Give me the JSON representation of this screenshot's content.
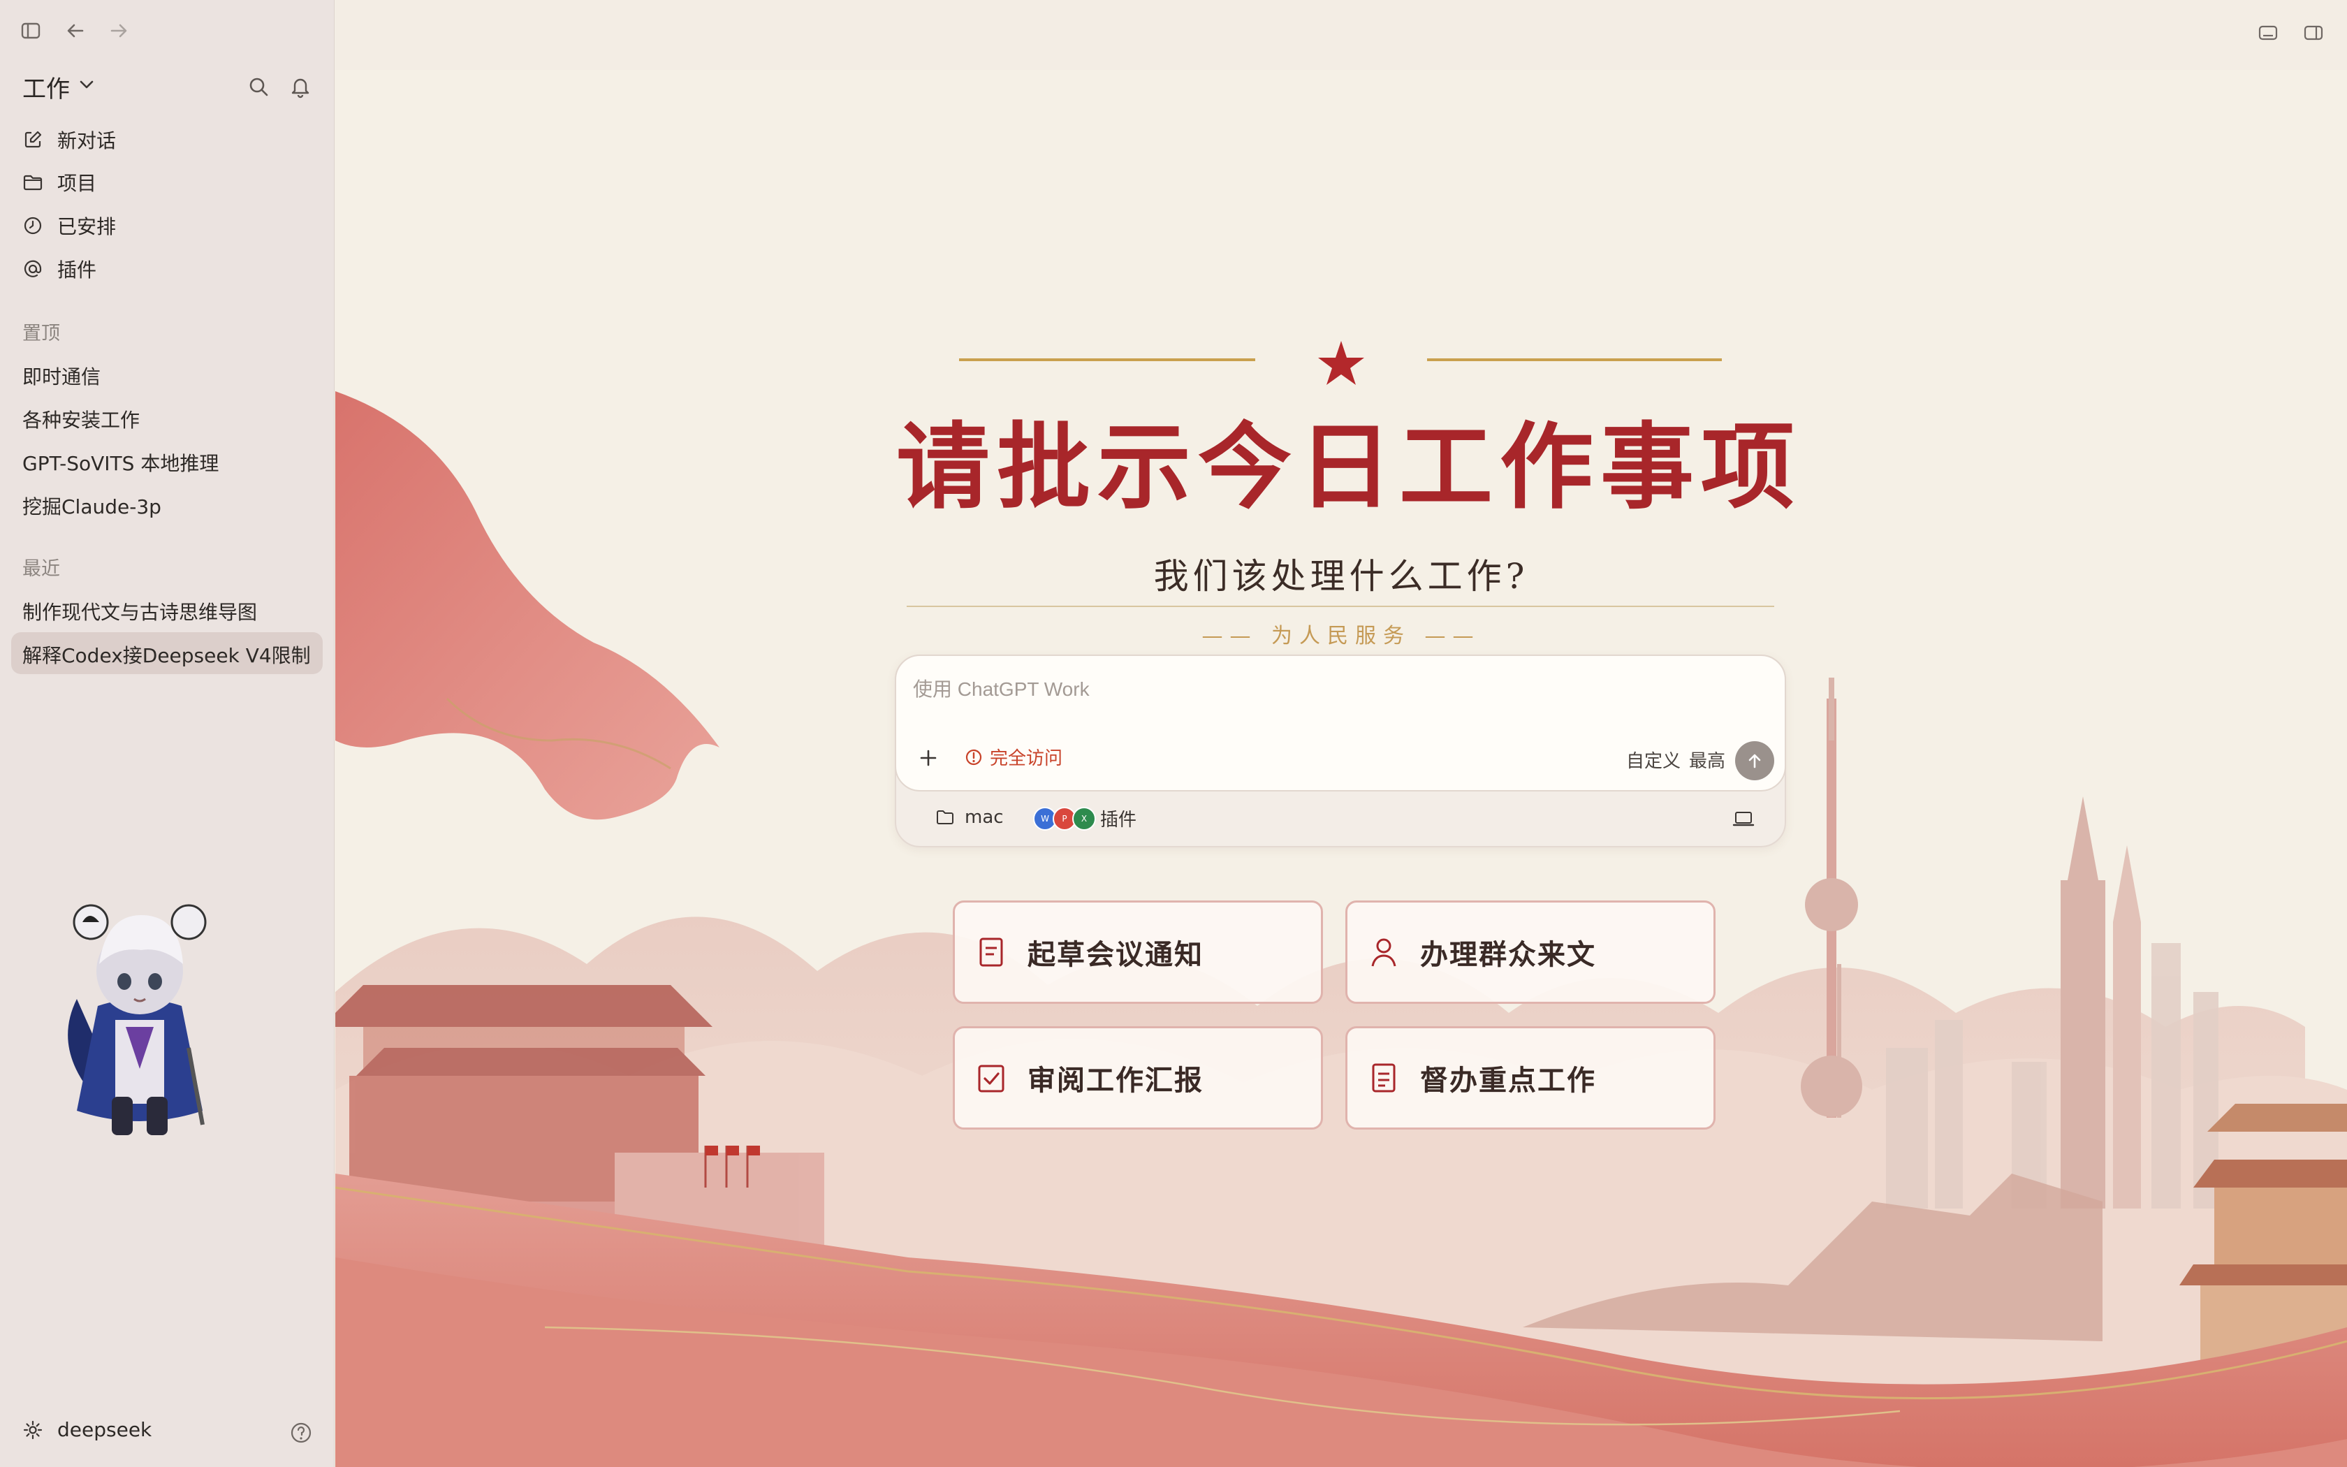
{
  "sidebar": {
    "workspace": "工作",
    "nav": [
      {
        "label": "新对话",
        "icon": "edit-icon"
      },
      {
        "label": "项目",
        "icon": "folder-icon"
      },
      {
        "label": "已安排",
        "icon": "clock-icon"
      },
      {
        "label": "插件",
        "icon": "at-icon"
      }
    ],
    "pinned_label": "置顶",
    "pinned": [
      "即时通信",
      "各种安装工作",
      "GPT-SoVITS 本地推理",
      "挖掘Claude-3p"
    ],
    "recent_label": "最近",
    "recent": [
      "制作现代文与古诗思维导图",
      "解释Codex接Deepseek V4限制"
    ],
    "account": "deepseek"
  },
  "main": {
    "title": "请批示今日工作事项",
    "subtitle": "我们该处理什么工作?",
    "motto": "—— 为人民服务 ——",
    "composer": {
      "placeholder": "使用 ChatGPT Work",
      "access_label": "完全访问",
      "custom_label": "自定义",
      "level_label": "最高",
      "folder_label": "mac",
      "plugins_label": "插件"
    },
    "cards": [
      {
        "label": "起草会议通知",
        "icon": "document-icon"
      },
      {
        "label": "办理群众来文",
        "icon": "person-icon"
      },
      {
        "label": "审阅工作汇报",
        "icon": "checkbox-icon"
      },
      {
        "label": "督办重点工作",
        "icon": "document-icon"
      }
    ]
  },
  "colors": {
    "accent_red": "#a8262a",
    "gold": "#c59a55",
    "sidebar_bg": "#ebe3e0",
    "card_border": "#e0b3ad",
    "warning_orange": "#c8432a"
  }
}
